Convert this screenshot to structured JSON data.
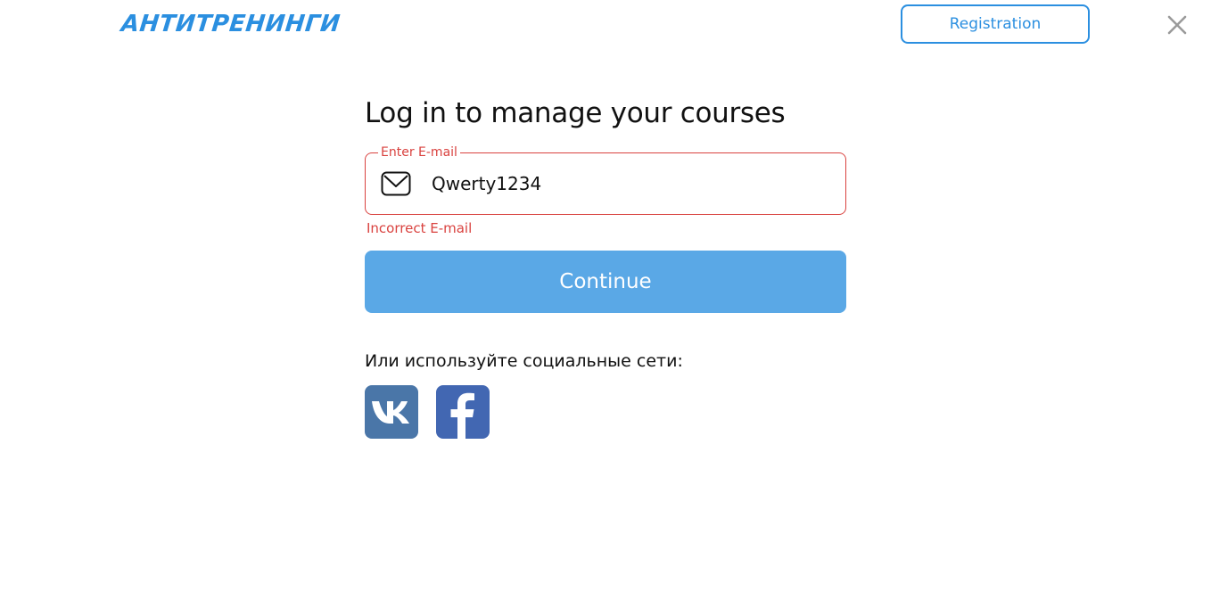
{
  "header": {
    "logo_text": "АНТИТРЕНИНГИ",
    "registration_label": "Registration"
  },
  "login_form": {
    "title": "Log in to manage your courses",
    "email_field": {
      "legend": "Enter E-mail",
      "value": "Qwerty1234",
      "error": "Incorrect E-mail"
    },
    "continue_label": "Continue",
    "social_caption": "Или используйте социальные сети:",
    "social_buttons": [
      {
        "icon": "vk-icon",
        "color": "#4a76a8"
      },
      {
        "icon": "facebook-icon",
        "color": "#4267b2"
      }
    ]
  },
  "colors": {
    "brand_blue": "#2b8fe0",
    "continue_button": "#5aa8e6",
    "error_red": "#d9423f"
  }
}
